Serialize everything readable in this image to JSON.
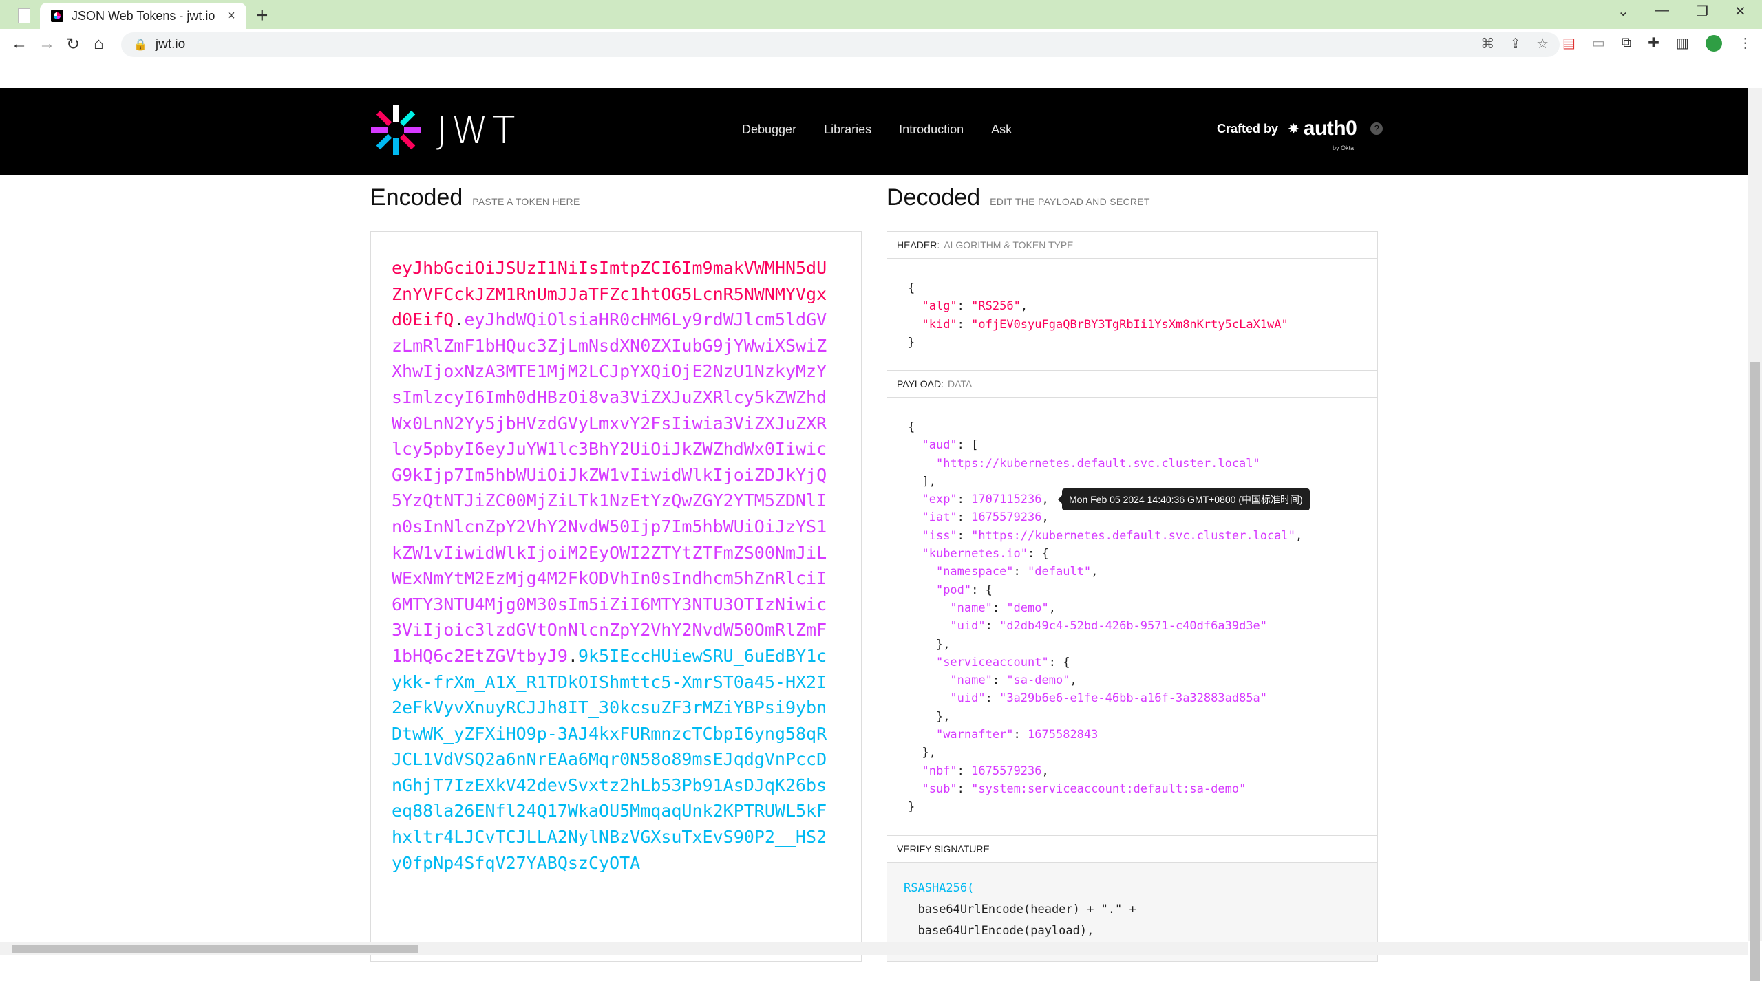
{
  "browser": {
    "tab_title": "JSON Web Tokens - jwt.io",
    "tab_close": "×",
    "new_tab": "+",
    "url": "jwt.io",
    "win_min": "—",
    "win_restore": "❐",
    "win_close": "✕",
    "win_chevron": "⌄"
  },
  "site": {
    "logo_text": "JWT",
    "nav": [
      "Debugger",
      "Libraries",
      "Introduction",
      "Ask"
    ],
    "crafted_by": "Crafted by",
    "auth0_name": "auth0",
    "by_okta": "by Okta",
    "help": "?"
  },
  "encoded": {
    "title": "Encoded",
    "subtitle": "PASTE A TOKEN HERE",
    "token_header": "eyJhbGciOiJSUzI1NiIsImtpZCI6Im9makVWMHN5dUZnYVFCckJZM1RnUmJJaTFZc1htOG5LcnR5NWNMYVgxd0EifQ",
    "token_payload": "eyJhdWQiOlsiaHR0cHM6Ly9rdWJlcm5ldGVzLmRlZmF1bHQuc3ZjLmNsdXN0ZXIubG9jYWwiXSwiZXhwIjoxNzA3MTE1MjM2LCJpYXQiOjE2NzU1NzkyMzYsImlzcyI6Imh0dHBzOi8va3ViZXJuZXRlcy5kZWZhdWx0LnN2Yy5jbHVzdGVyLmxvY2FsIiwia3ViZXJuZXRlcy5pbyI6eyJuYW1lc3BhY2UiOiJkZWZhdWx0IiwicG9kIjp7Im5hbWUiOiJkZW1vIiwidWlkIjoiZDJkYjQ5YzQtNTJiZC00MjZiLTk1NzEtYzQwZGY2YTM5ZDNlIn0sInNlcnZpY2VhY2NvdW50Ijp7Im5hbWUiOiJzYS1kZW1vIiwidWlkIjoiM2EyOWI2ZTYtZTFmZS00NmJiLWExNmYtM2EzMjg4M2FkODVhIn0sIndhcm5hZnRlciI6MTY3NTU4Mjg0M30sIm5iZiI6MTY3NTU3OTIzNiwic3ViIjoic3lzdGVtOnNlcnZpY2VhY2NvdW50OmRlZmF1bHQ6c2EtZGVtbyJ9",
    "token_sig": "9k5IEccHUiewSRU_6uEdBY1cykk-frXm_A1X_R1TDkOIShmttc5-XmrST0a45-HX2I2eFkVyvXnuyRCJJh8IT_30kcsuZF3rMZiYBPsi9ybnDtwWK_yZFXiHO9p-3AJ4kxFURmnzcTCbpI6yng58qRJCL1VdVSQ2a6nNrEAa6Mqr0N58o89msEJqdgVnPccDnGhjT7IzEXkV42devSvxtz2hLb53Pb91AsDJqK26bseq88la26ENfl24Q17WkaOU5MmqaqUnk2KPTRUWL5kFhxltr4LJCvTCJLLA2NylNBzVGXsuTxEvS90P2__HS2y0fpNp4SfqV27YABQszCyOTA",
    "dot": "."
  },
  "decoded": {
    "title": "Decoded",
    "subtitle": "EDIT THE PAYLOAD AND SECRET",
    "header_label": "HEADER:",
    "header_sub": "ALGORITHM & TOKEN TYPE",
    "payload_label": "PAYLOAD:",
    "payload_sub": "DATA",
    "verify_label": "VERIFY SIGNATURE",
    "header_json": {
      "alg_key": "\"alg\"",
      "alg_val": "\"RS256\"",
      "kid_key": "\"kid\"",
      "kid_val": "\"ofjEV0syuFgaQBrBY3TgRbIi1YsXm8nKrty5cLaX1wA\""
    },
    "payload_json": {
      "aud_key": "\"aud\"",
      "aud_val": "\"https://kubernetes.default.svc.cluster.local\"",
      "exp_key": "\"exp\"",
      "exp_val": "1707115236",
      "iat_key": "\"iat\"",
      "iat_val": "1675579236",
      "iss_key": "\"iss\"",
      "iss_val": "\"https://kubernetes.default.svc.cluster.local\"",
      "k8s_key": "\"kubernetes.io\"",
      "ns_key": "\"namespace\"",
      "ns_val": "\"default\"",
      "pod_key": "\"pod\"",
      "pod_name_key": "\"name\"",
      "pod_name_val": "\"demo\"",
      "pod_uid_key": "\"uid\"",
      "pod_uid_val": "\"d2db49c4-52bd-426b-9571-c40df6a39d3e\"",
      "sa_key": "\"serviceaccount\"",
      "sa_name_key": "\"name\"",
      "sa_name_val": "\"sa-demo\"",
      "sa_uid_key": "\"uid\"",
      "sa_uid_val": "\"3a29b6e6-e1fe-46bb-a16f-3a32883ad85a\"",
      "warn_key": "\"warnafter\"",
      "warn_val": "1675582843",
      "nbf_key": "\"nbf\"",
      "nbf_val": "1675579236",
      "sub_key": "\"sub\"",
      "sub_val": "\"system:serviceaccount:default:sa-demo\""
    },
    "exp_tooltip": "Mon Feb 05 2024 14:40:36 GMT+0800 (中国标准时间)",
    "verify_fn": "RSASHA256(",
    "verify_line2": "base64UrlEncode(header) + \".\" +",
    "verify_line3": "base64UrlEncode(payload),"
  },
  "colors": {
    "header": "#fb015b",
    "payload": "#d63aff",
    "signature": "#00b9f1"
  }
}
